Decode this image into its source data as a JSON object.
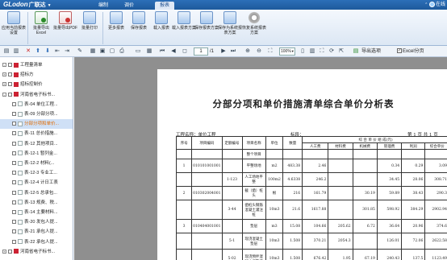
{
  "app": {
    "logo": "GLodon",
    "subtitle": "广联达",
    "dropdown": "▼",
    "right_text": "在线"
  },
  "menu_tabs": [
    "编制",
    "调价",
    "报表"
  ],
  "ribbon": {
    "buttons": [
      "应用当前报表设置",
      "批量导出Excel",
      "批量导出PDF",
      "批量打印",
      "更多报表",
      "保存报表",
      "载入报表",
      "载入报表方案",
      "保存报表方案",
      "保存为系统报表方案",
      "恢复系统报表方案"
    ]
  },
  "toolbar": {
    "page": "1",
    "page_of": "/1",
    "zoom": "100%",
    "export_label": "导出选项",
    "excel_page_label": "Excel分页"
  },
  "sidebar": {
    "items": [
      {
        "label": "工程量清单",
        "indent": 1,
        "expand": "-",
        "icon": "red",
        "checked": false
      },
      {
        "label": "招标方",
        "indent": 1,
        "expand": "+",
        "icon": "red",
        "checked": false
      },
      {
        "label": "招标控制价",
        "indent": 1,
        "expand": "+",
        "icon": "red",
        "checked": false
      },
      {
        "label": "河南省电子标书...",
        "indent": 1,
        "expand": "-",
        "icon": "red",
        "checked": false
      },
      {
        "label": "表-04 单位工程...",
        "indent": 2,
        "expand": "",
        "icon": "doc",
        "checked": false
      },
      {
        "label": "表-09 分部分项...",
        "indent": 2,
        "expand": "",
        "icon": "doc",
        "checked": false
      },
      {
        "label": "分部分项和单价...",
        "indent": 2,
        "expand": "",
        "icon": "doc",
        "checked": true,
        "selected": true
      },
      {
        "label": "表-11 总价措施...",
        "indent": 2,
        "expand": "",
        "icon": "doc",
        "checked": false
      },
      {
        "label": "表-12 其他项目...",
        "indent": 2,
        "expand": "",
        "icon": "doc",
        "checked": false
      },
      {
        "label": "表-12-1 暂列金...",
        "indent": 2,
        "expand": "",
        "icon": "doc",
        "checked": false
      },
      {
        "label": "表-12-2 材料(...",
        "indent": 2,
        "expand": "",
        "icon": "doc",
        "checked": false
      },
      {
        "label": "表-12-3 专业工...",
        "indent": 2,
        "expand": "",
        "icon": "doc",
        "checked": false
      },
      {
        "label": "表-12-4 计日工表",
        "indent": 2,
        "expand": "",
        "icon": "doc",
        "checked": false
      },
      {
        "label": "表-12-5 总承包...",
        "indent": 2,
        "expand": "",
        "icon": "doc",
        "checked": false
      },
      {
        "label": "表-13 规费、税...",
        "indent": 2,
        "expand": "",
        "icon": "doc",
        "checked": false
      },
      {
        "label": "表-14 主要材料...",
        "indent": 2,
        "expand": "",
        "icon": "doc",
        "checked": false
      },
      {
        "label": "表-20 发包人提...",
        "indent": 2,
        "expand": "",
        "icon": "doc",
        "checked": false
      },
      {
        "label": "表-21 承包人提...",
        "indent": 2,
        "expand": "",
        "icon": "doc",
        "checked": false
      },
      {
        "label": "表-22 承包人提...",
        "indent": 2,
        "expand": "",
        "icon": "doc",
        "checked": false
      },
      {
        "label": "河南省电子标书...",
        "indent": 1,
        "expand": "+",
        "icon": "red",
        "checked": false
      }
    ]
  },
  "report": {
    "title": "分部分项和单价措施清单综合单价分析表",
    "project_label": "工程名称：单位工程",
    "section_label": "标段：",
    "page_label": "第 1 页 共 1 页",
    "headers": {
      "seq": "序号",
      "item_code": "项目编码",
      "quota_code": "定额编号",
      "item_name": "项目名称",
      "unit": "单位",
      "qty": "数量",
      "unit_price_group": "综 合 单 价 组 成(元)",
      "labor": "人工费",
      "material": "材料费",
      "machine": "机械费",
      "mgmt": "管理费",
      "profit": "利润",
      "unit_price": "综合单价"
    },
    "rows": [
      {
        "seq": "",
        "code": "",
        "quota": "",
        "name": "整个项目",
        "unit": "",
        "qty": "",
        "labor": "",
        "material": "",
        "machine": "",
        "mgmt": "",
        "profit": "",
        "price": ""
      },
      {
        "seq": "1",
        "code": "010101001001",
        "quota": "",
        "name": "平整场地",
        "unit": "m2",
        "qty": "483.38",
        "labor": "2.46",
        "material": "",
        "machine": "",
        "mgmt": "0.34",
        "profit": "0.29",
        "price": "3.09"
      },
      {
        "seq": "",
        "code": "",
        "quota": "1-123",
        "name": "人工场地平整",
        "unit": "100m2",
        "qty": "4.6338",
        "labor": "246.2",
        "material": "",
        "machine": "",
        "mgmt": "34.45",
        "profit": "28.06",
        "price": "308.71"
      },
      {
        "seq": "2",
        "code": "010302004001",
        "quota": "",
        "name": "截（凿）桩头",
        "unit": "根",
        "qty": "216",
        "labor": "161.79",
        "material": "",
        "machine": "30.19",
        "mgmt": "59.89",
        "profit": "38.43",
        "price": "290.3"
      },
      {
        "seq": "",
        "code": "",
        "quota": "3-44",
        "name": "凿桩头钢筋混凝土灌注桩",
        "unit": "10m3",
        "qty": "21.6",
        "labor": "1617.88",
        "material": "",
        "machine": "301.85",
        "mgmt": "598.92",
        "profit": "384.29",
        "price": "2902.94"
      },
      {
        "seq": "3",
        "code": "010404001001",
        "quota": "",
        "name": "垫层",
        "unit": "m3",
        "qty": "15.08",
        "labor": "104.66",
        "material": "205.62",
        "machine": "6.72",
        "mgmt": "36.64",
        "profit": "20.96",
        "price": "374.6"
      },
      {
        "seq": "",
        "code": "",
        "quota": "5-1",
        "name": "现浇混凝土垫层",
        "unit": "10m3",
        "qty": "1.508",
        "labor": "370.21",
        "material": "2054.3",
        "machine": "",
        "mgmt": "126.01",
        "profit": "72.06",
        "price": "2622.58"
      },
      {
        "seq": "",
        "code": "",
        "quota": "5-02",
        "name": "现浇预拌混凝土调整费",
        "unit": "10m3",
        "qty": "1.508",
        "labor": "676.42",
        "material": "1.95",
        "machine": "67.19",
        "mgmt": "240.43",
        "profit": "137.5",
        "price": "1123.49"
      }
    ]
  }
}
